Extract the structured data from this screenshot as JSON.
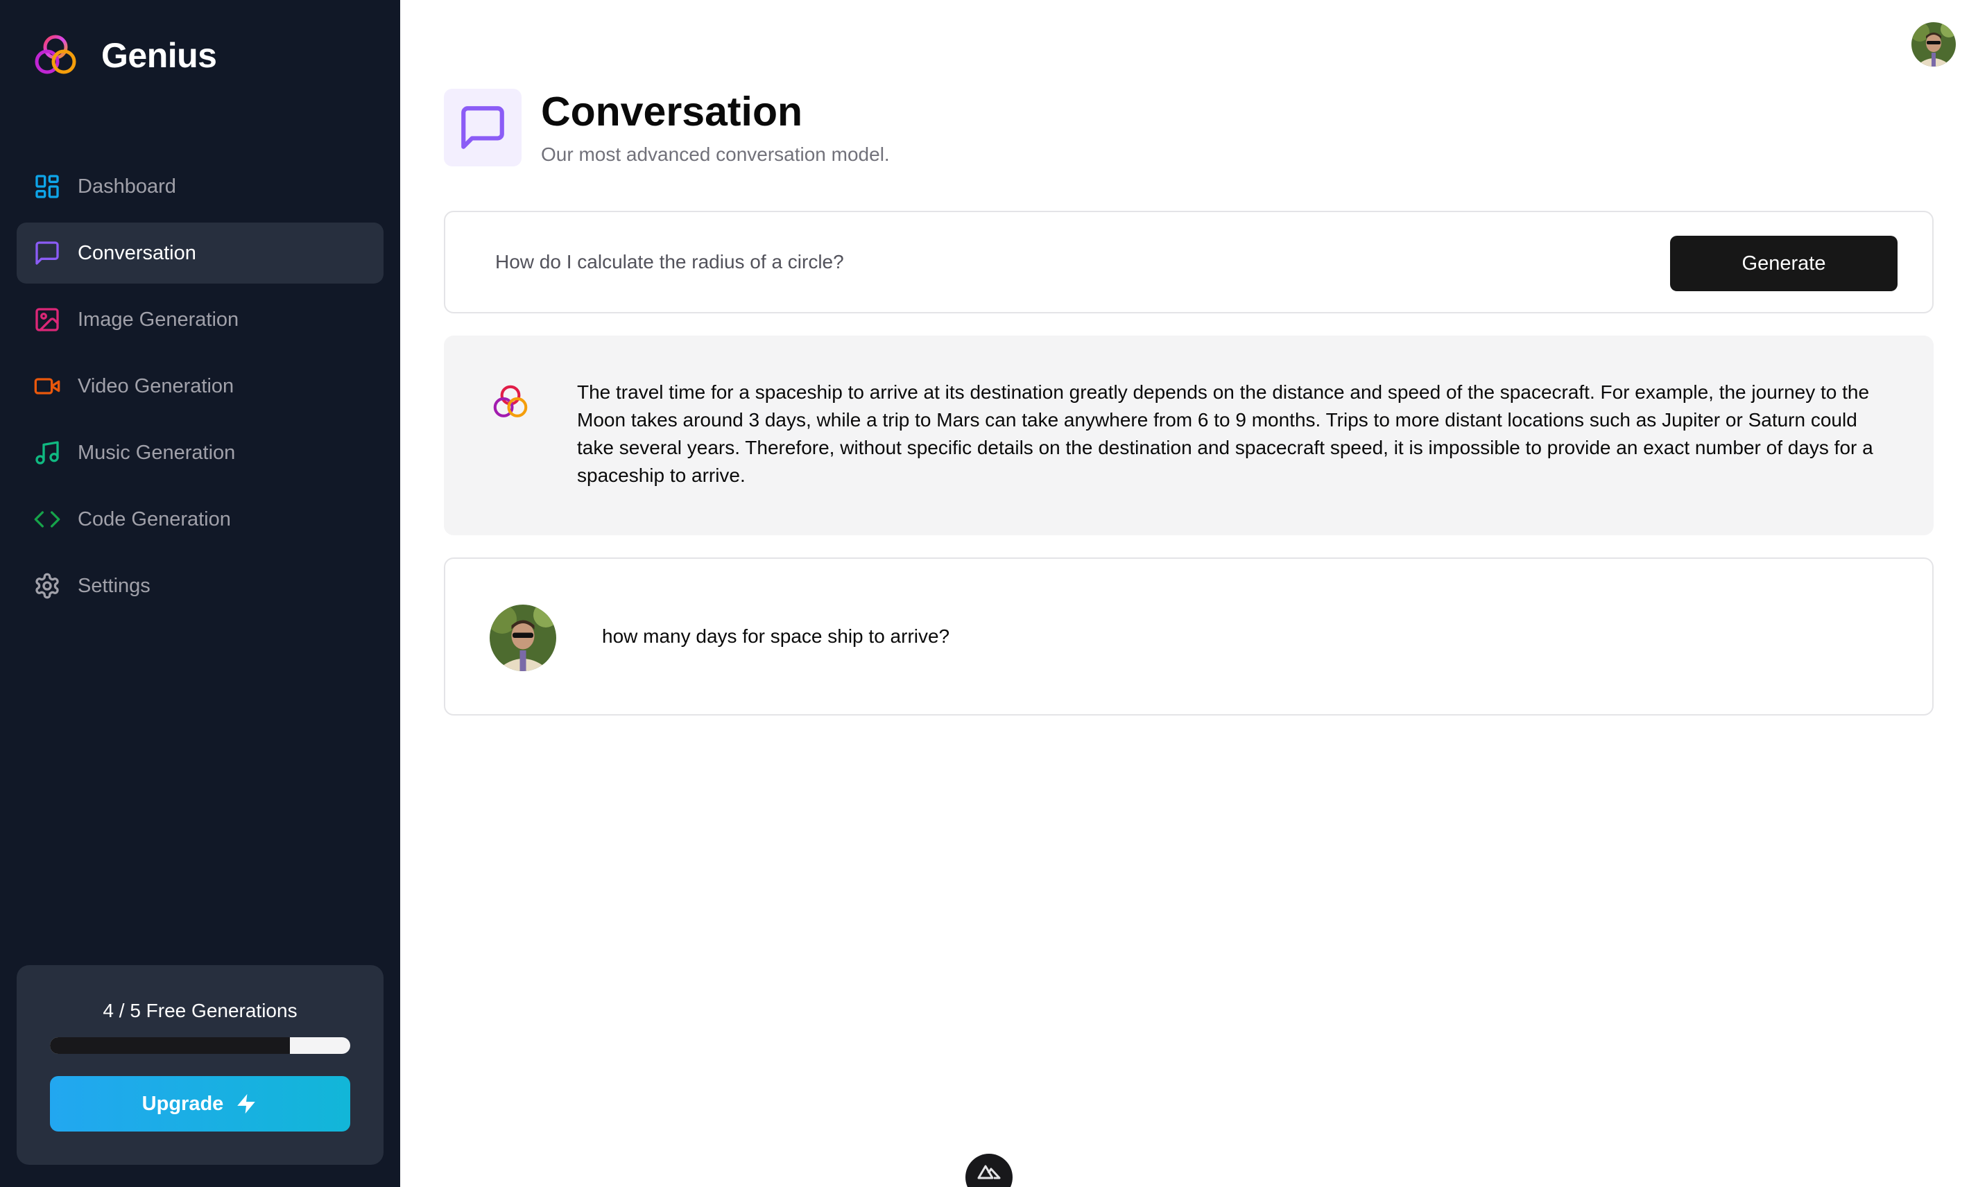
{
  "app": {
    "name": "Genius"
  },
  "sidebar": {
    "items": [
      {
        "label": "Dashboard",
        "icon": "dashboard-icon",
        "color": "#0ea5e9",
        "active": false
      },
      {
        "label": "Conversation",
        "icon": "message-square-icon",
        "color": "#8b5cf6",
        "active": true
      },
      {
        "label": "Image Generation",
        "icon": "image-icon",
        "color": "#db2777",
        "active": false
      },
      {
        "label": "Video Generation",
        "icon": "video-icon",
        "color": "#ea580c",
        "active": false
      },
      {
        "label": "Music Generation",
        "icon": "music-icon",
        "color": "#10b981",
        "active": false
      },
      {
        "label": "Code Generation",
        "icon": "code-icon",
        "color": "#16a34a",
        "active": false
      },
      {
        "label": "Settings",
        "icon": "settings-icon",
        "color": "#a1a1aa",
        "active": false
      }
    ],
    "free_counter": {
      "text": "4 / 5 Free Generations",
      "used": 4,
      "limit": 5,
      "upgrade_label": "Upgrade"
    }
  },
  "header": {
    "title": "Conversation",
    "subtitle": "Our most advanced conversation model.",
    "accent_color": "#8b5cf6"
  },
  "form": {
    "placeholder": "How do I calculate the radius of a circle?",
    "value": "",
    "submit_label": "Generate"
  },
  "messages": [
    {
      "role": "bot",
      "text": "The travel time for a spaceship to arrive at its destination greatly depends on the distance and speed of the spacecraft. For example, the journey to the Moon takes around 3 days, while a trip to Mars can take anywhere from 6 to 9 months. Trips to more distant locations such as Jupiter or Saturn could take several years. Therefore, without specific details on the destination and spacecraft speed, it is impossible to provide an exact number of days for a spaceship to arrive."
    },
    {
      "role": "user",
      "text": "how many days for space ship to arrive?"
    }
  ]
}
